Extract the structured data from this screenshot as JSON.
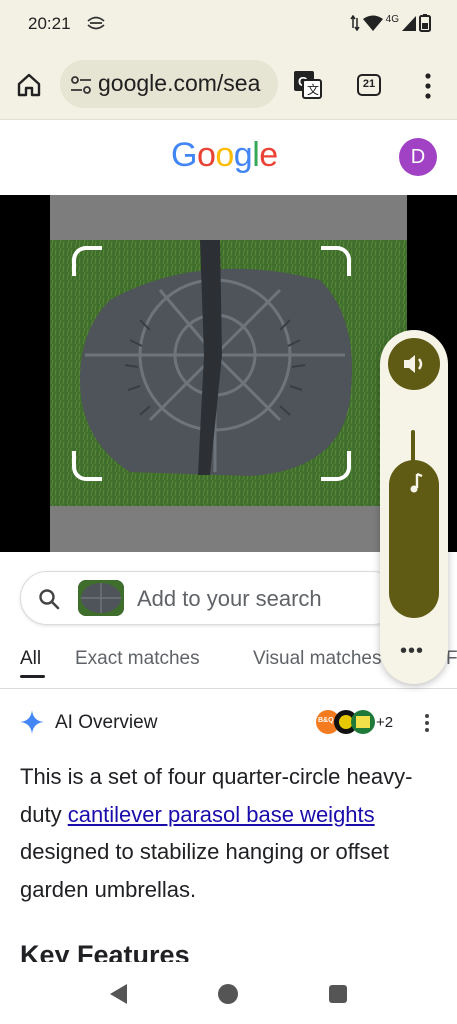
{
  "status_bar": {
    "time": "20:21",
    "network_label": "4G",
    "icons": [
      "sync-icon",
      "data-arrows-icon",
      "wifi-icon",
      "signal-icon",
      "battery-icon"
    ]
  },
  "browser": {
    "url": "google.com/sea",
    "tab_count": "21",
    "icons": [
      "home-icon",
      "tune-icon",
      "translate-icon",
      "more-vert-icon"
    ]
  },
  "google": {
    "logo_letters": [
      "G",
      "o",
      "o",
      "g",
      "l",
      "e"
    ],
    "logo_colors": [
      "#4285F4",
      "#EA4335",
      "#FBBC05",
      "#4285F4",
      "#34A853",
      "#EA4335"
    ],
    "avatar_letter": "D",
    "avatar_color": "#A142C4"
  },
  "volume_panel": {
    "more_label": "•••",
    "level": 0.85,
    "accent": "#5F5B15"
  },
  "search": {
    "placeholder": "Add to your search"
  },
  "tabs": [
    {
      "label": "All",
      "active": true
    },
    {
      "label": "Exact matches",
      "active": false
    },
    {
      "label": "Visual matches",
      "active": false
    },
    {
      "label": "F",
      "active": false
    }
  ],
  "ai_overview": {
    "title": "AI Overview",
    "source_badge": "B&Q",
    "source_count": "+2",
    "text_before": "This is a set of four quarter-circle heavy-duty ",
    "link_text": "cantilever parasol base weights",
    "text_after": " designed to stabilize hanging or offset garden umbrellas.",
    "next_heading": "Key Features"
  },
  "colors": {
    "chrome_bg": "#F3F1E4",
    "link": "#1A0DAB"
  }
}
